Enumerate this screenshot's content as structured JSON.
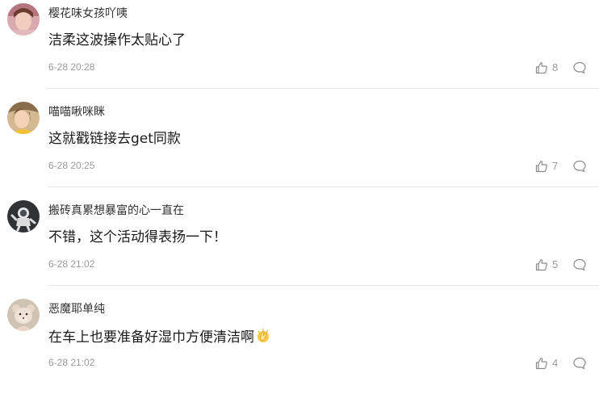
{
  "colors": {
    "text": "#1a1a1a",
    "muted": "#9a9a9a",
    "divider": "#e6e6e6"
  },
  "comments": [
    {
      "username": "樱花味女孩吖咦",
      "content": "洁柔这波操作太贴心了",
      "time": "6-28 20:28",
      "likes": "8",
      "avatar_icon": "avatar-icon"
    },
    {
      "username": "喵喵啾咪眯",
      "content": "这就戳链接去get同款",
      "time": "6-28 20:25",
      "likes": "7",
      "avatar_icon": "avatar-icon"
    },
    {
      "username": "搬砖真累想暴富的心一直在",
      "content": "不错，这个活动得表扬一下！",
      "time": "6-28 21:02",
      "likes": "5",
      "avatar_icon": "astronaut-avatar-icon"
    },
    {
      "username": "恶魔耶单纯",
      "content": "在车上也要准备好湿巾方便清洁啊",
      "time": "6-28 21:02",
      "likes": "4",
      "avatar_icon": "teddy-bear-avatar-icon",
      "emoji": "clapping-hands-emoji"
    }
  ]
}
